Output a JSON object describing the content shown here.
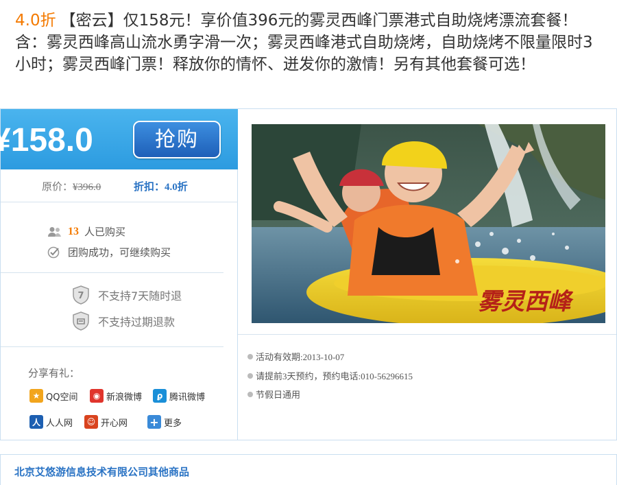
{
  "deal": {
    "discount_label": "4.0折",
    "title": "【密云】仅158元！享价值396元的雾灵西峰门票港式自助烧烤漂流套餐！含：雾灵西峰高山流水勇字滑一次；雾灵西峰港式自助烧烤，自助烧烤不限量限时3小时；雾灵西峰门票！释放你的情怀、迸发你的激情！另有其他套餐可选！"
  },
  "price": {
    "currency": "¥",
    "current": "158.0",
    "buy_label": "抢购",
    "original_label": "原价：",
    "original_value": "¥396.0",
    "discount_label": "折扣：",
    "discount_value": "4.0折"
  },
  "stats": {
    "buyers_count": "13",
    "buyers_suffix": "人已购买",
    "status_text": "团购成功，可继续购买"
  },
  "policies": [
    {
      "icon": "shield-7-icon",
      "text": "不支持7天随时退"
    },
    {
      "icon": "shield-refund-icon",
      "text": "不支持过期退款"
    }
  ],
  "share": {
    "title": "分享有礼：",
    "items": [
      {
        "label": "QQ空间",
        "icon": "qzone-icon",
        "color": "#f2a51d"
      },
      {
        "label": "新浪微博",
        "icon": "weibo-icon",
        "color": "#e0342c"
      },
      {
        "label": "腾讯微博",
        "icon": "tencent-weibo-icon",
        "color": "#1a8fd8"
      },
      {
        "label": "人人网",
        "icon": "renren-icon",
        "color": "#1d5fb1"
      },
      {
        "label": "开心网",
        "icon": "kaixin-icon",
        "color": "#d9431e"
      },
      {
        "label": "更多",
        "icon": "plus-icon",
        "color": "#3a8ad8"
      }
    ]
  },
  "photo": {
    "caption": "雾灵西峰"
  },
  "info": [
    "活动有效期:2013-10-07",
    "请提前3天预约，预约电话:010-56296615",
    "节假日通用"
  ],
  "company": {
    "link_text": "北京艾悠游信息技术有限公司其他商品"
  },
  "colors": {
    "accent_orange": "#f47a00",
    "price_bar": "#2c9be0",
    "link_blue": "#2a73c4"
  }
}
